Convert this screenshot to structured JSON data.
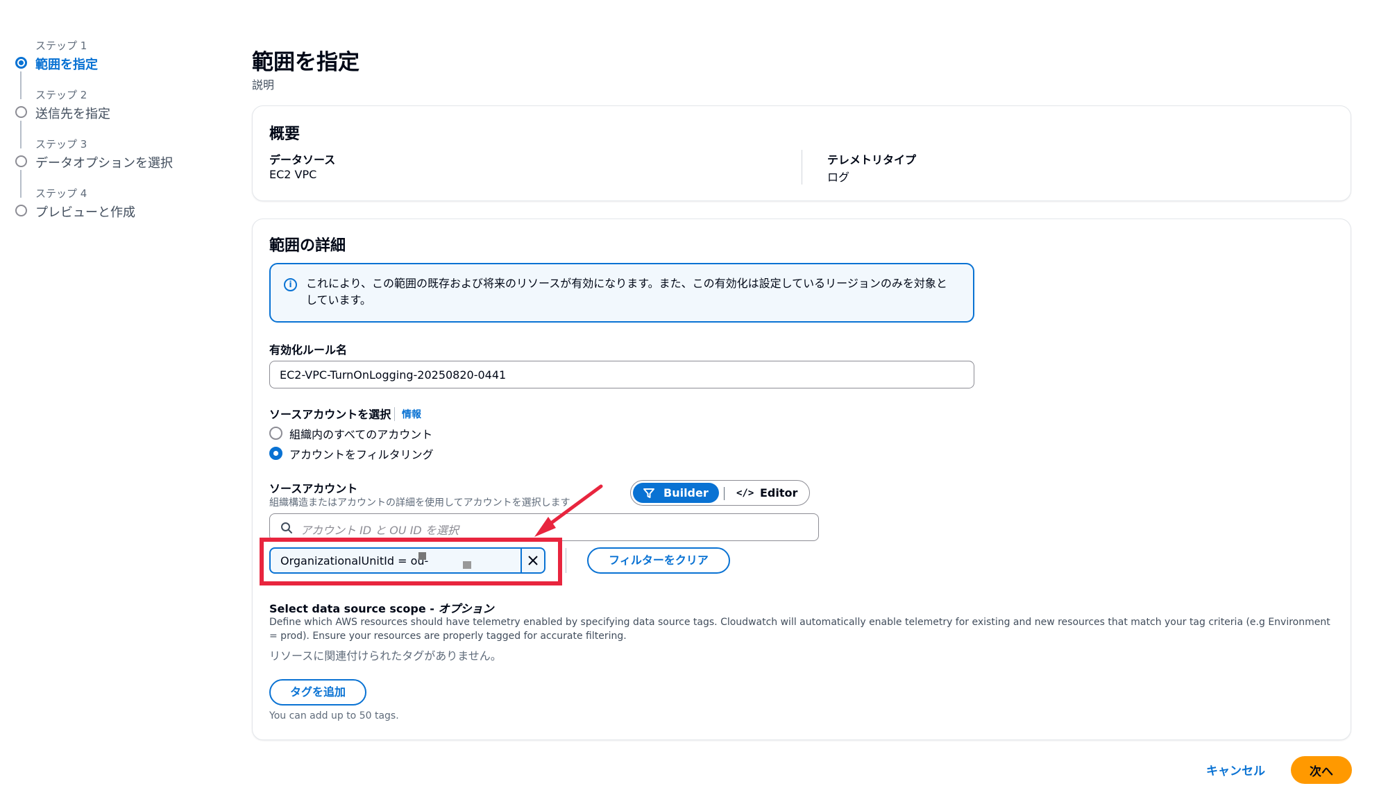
{
  "steps": [
    {
      "label": "ステップ 1",
      "name": "範囲を指定",
      "active": true
    },
    {
      "label": "ステップ 2",
      "name": "送信先を指定",
      "active": false
    },
    {
      "label": "ステップ 3",
      "name": "データオプションを選択",
      "active": false
    },
    {
      "label": "ステップ 4",
      "name": "プレビューと作成",
      "active": false
    }
  ],
  "header": {
    "title": "範囲を指定",
    "description": "説明"
  },
  "overview": {
    "title": "概要",
    "data_source_label": "データソース",
    "data_source_value": "EC2 VPC",
    "telemetry_type_label": "テレメトリタイプ",
    "telemetry_type_value": "ログ"
  },
  "details": {
    "title": "範囲の詳細",
    "alert_text": "これにより、この範囲の既存および将来のリソースが有効になります。また、この有効化は設定しているリージョンのみを対象としています。",
    "rule_name_label": "有効化ルール名",
    "rule_name_value": "EC2-VPC-TurnOnLogging-20250820-0441",
    "source_account_select_label": "ソースアカウントを選択",
    "info_link": "情報",
    "radio_all": "組織内のすべてのアカウント",
    "radio_filter": "アカウントをフィルタリング",
    "source_account_label": "ソースアカウント",
    "source_account_hint": "組織構造またはアカウントの詳細を使用してアカウントを選択します",
    "toggle_builder": "Builder",
    "toggle_editor": "Editor",
    "search_placeholder": "アカウント ID と OU ID を選択",
    "filter_token": "OrganizationalUnitId = ou-",
    "clear_filters": "フィルターをクリア",
    "scope_title": "Select data source scope - ",
    "scope_title_optional": "オプション",
    "scope_description": "Define which AWS resources should have telemetry enabled by specifying data source tags. Cloudwatch will automatically enable telemetry for existing and new resources that match your tag criteria (e.g Environment = prod). Ensure your resources are properly tagged for accurate filtering.",
    "no_tags": "リソースに関連付けられたタグがありません。",
    "add_tag": "タグを追加",
    "tag_limit": "You can add up to 50 tags."
  },
  "footer": {
    "cancel": "キャンセル",
    "next": "次へ"
  },
  "colors": {
    "accent": "#0972d3",
    "primary_button": "#ff9900",
    "annotation": "#e8253e"
  }
}
